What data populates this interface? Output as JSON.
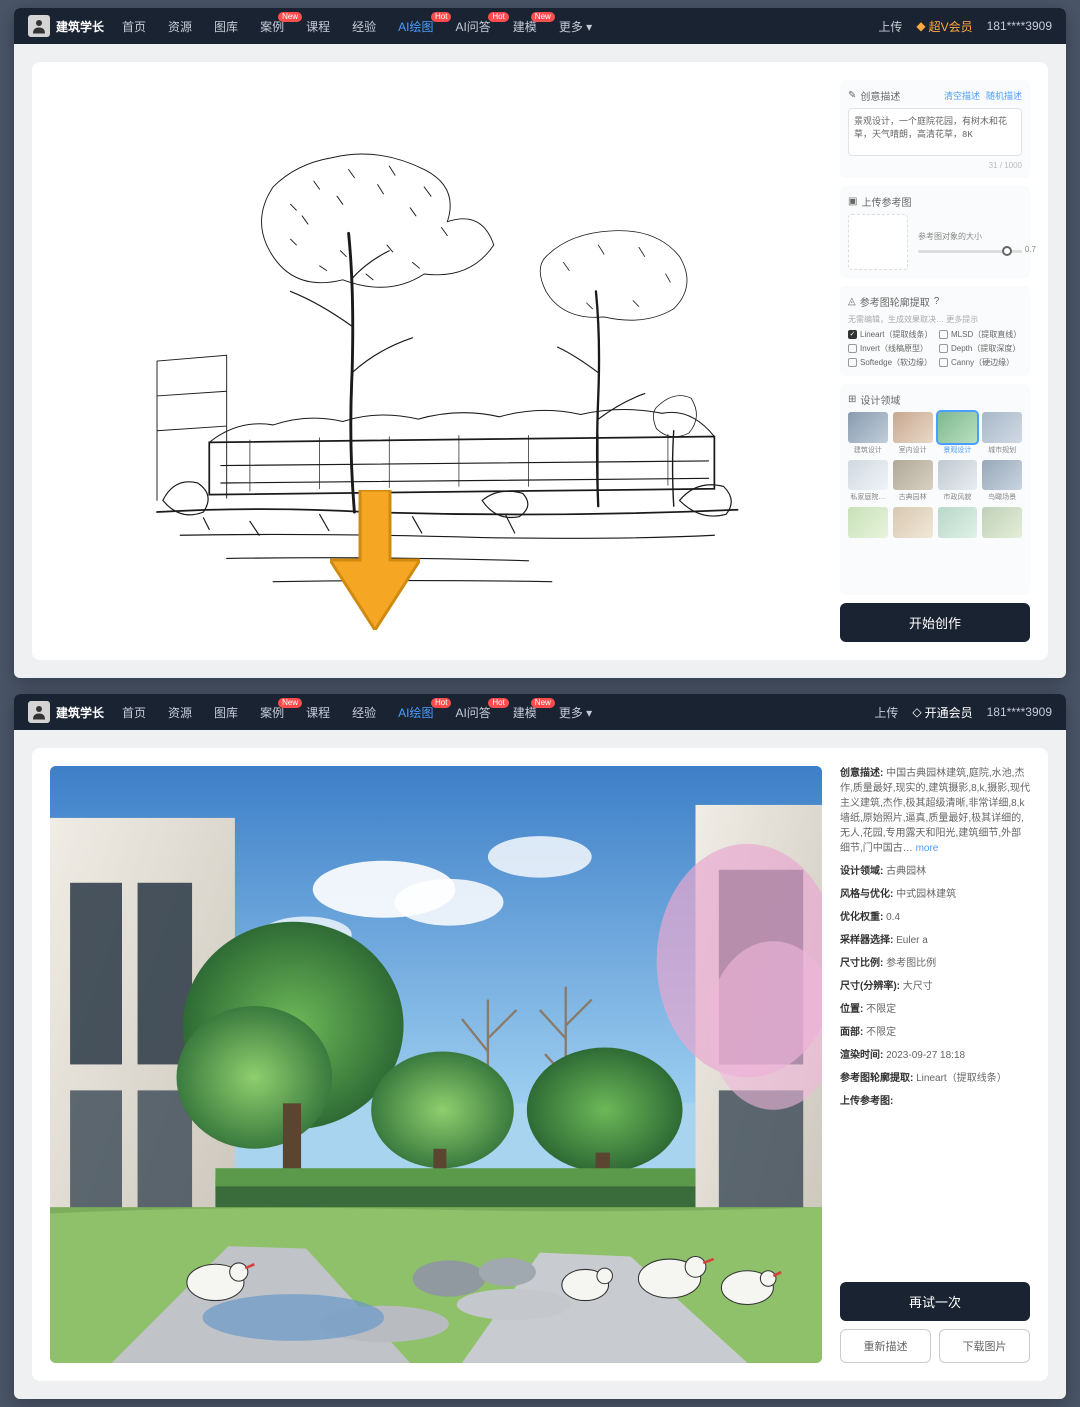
{
  "brand": "建筑学长",
  "nav": {
    "home": "首页",
    "resource": "资源",
    "gallery": "图库",
    "cases": "案例",
    "courses": "课程",
    "exp": "经验",
    "ai_draw": "AI绘图",
    "ai_qa": "AI问答",
    "build": "建模",
    "more": "更多",
    "badge_new": "New",
    "badge_hot": "Hot"
  },
  "topright": {
    "upload": "上传",
    "vip": "超V会员",
    "open_vip": "开通会员",
    "phone": "181****3909"
  },
  "input_panel": {
    "prompt_label": "创意描述",
    "link_clear": "清空描述",
    "link_random": "随机描述",
    "prompt_value": "景观设计，一个庭院花园，有树木和花草，天气晴朗，高清花草，8K",
    "char_count": "31 / 1000",
    "upload_ref_label": "上传参考图",
    "ref_intensity_label": "参考图对象的大小",
    "ref_intensity_value": "0.7",
    "extract_label": "参考图轮廓提取",
    "extract_help": "?",
    "extract_subnote": "无需编辑，生成效果取决…  更多提示",
    "options": {
      "lineart": "Lineart（提取线条）",
      "mlsd": "MLSD（提取直线）",
      "invert": "Invert（线稿原型）",
      "depth": "Depth（提取深度）",
      "softedge": "Softedge（软边缘）",
      "canny": "Canny（硬边缘）"
    },
    "domain_label": "设计领域",
    "domains": {
      "arch": "建筑设计",
      "interior": "室内设计",
      "landscape": "景观设计",
      "planning": "城市规划",
      "garden": "私家庭院…",
      "classical": "古典园林",
      "public": "市政风貌",
      "bird": "鸟瞰场景"
    },
    "start_btn": "开始创作"
  },
  "output_panel": {
    "creative_desc_label": "创意描述:",
    "creative_desc_value": "中国古典园林建筑,庭院,水池,杰作,质量最好,现实的,建筑摄影,8,k,摄影,现代主义建筑,杰作,极其超级清晰,非常详细,8,k墙纸,原始照片,逼真,质量最好,极其详细的,无人,花园,专用露天和阳光,建筑细节,外部细节,门中国古…",
    "more": "more",
    "design_domain_label": "设计领域:",
    "design_domain_value": "古典园林",
    "style_opt_label": "风格与优化:",
    "style_opt_value": "中式园林建筑",
    "opt_weight_label": "优化权重:",
    "opt_weight_value": "0.4",
    "sampler_label": "采样器选择:",
    "sampler_value": "Euler a",
    "ratio_label": "尺寸比例:",
    "ratio_value": "参考图比例",
    "size_label": "尺寸(分辨率):",
    "size_value": "大尺寸",
    "seed_label": "位置:",
    "seed_value": "不限定",
    "facefix_label": "面部:",
    "facefix_value": "不限定",
    "render_time_label": "渲染时间:",
    "render_time_value": "2023-09-27 18:18",
    "extract_label": "参考图轮廓提取:",
    "extract_value": "Lineart（提取线条）",
    "upload_ref_label": "上传参考图:",
    "retry_btn": "再试一次",
    "reedit_btn": "重新描述",
    "download_btn": "下载图片"
  }
}
